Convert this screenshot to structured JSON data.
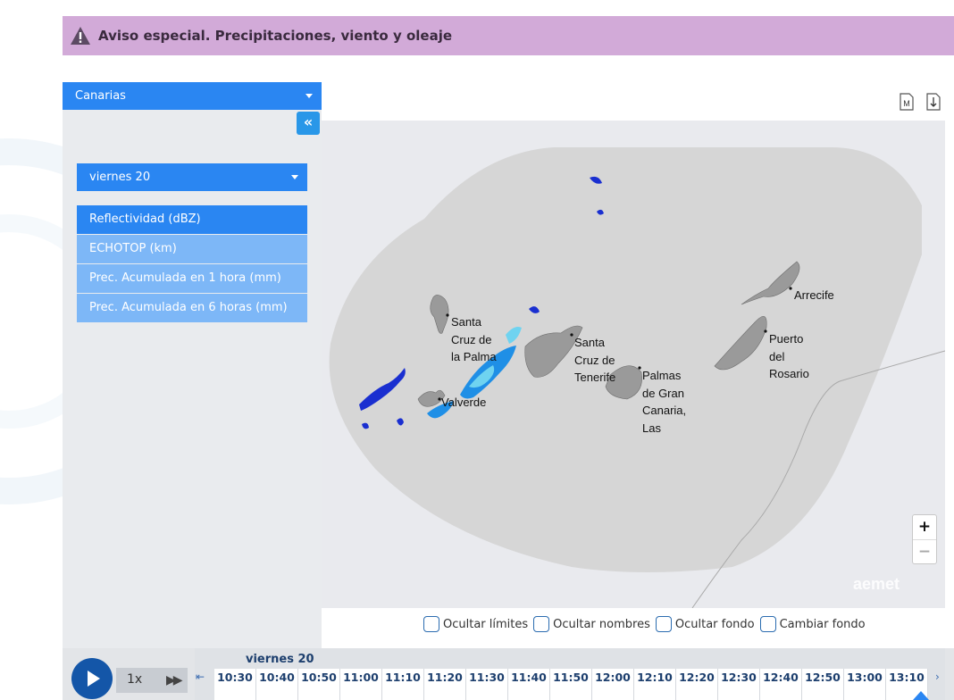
{
  "alert": {
    "text": "Aviso especial. Precipitaciones, viento y oleaje",
    "icon": "warning-icon"
  },
  "region_select": {
    "value": "Canarias"
  },
  "collapse_button": {
    "label": "«"
  },
  "day_select": {
    "value": "viernes 20"
  },
  "products": [
    {
      "label": "Reflectividad (dBZ)",
      "active": true
    },
    {
      "label": "ECHOTOP (km)",
      "active": false
    },
    {
      "label": "Prec. Acumulada en 1 hora (mm)",
      "active": false
    },
    {
      "label": "Prec. Acumulada en 6 horas (mm)",
      "active": false
    }
  ],
  "map_tools": [
    {
      "name": "map-layer-icon",
      "label": "M"
    },
    {
      "name": "download-icon",
      "label": "↓"
    }
  ],
  "map": {
    "places": [
      {
        "name": "Santa Cruz de la Palma",
        "label": "Santa\nCruz de\nla Palma"
      },
      {
        "name": "Valverde",
        "label": "Valverde"
      },
      {
        "name": "Santa Cruz de Tenerife",
        "label": "Santa\nCruz de\nTenerife"
      },
      {
        "name": "Palmas de Gran Canaria, Las",
        "label": "Palmas\nde Gran\nCanaria,\nLas"
      },
      {
        "name": "Arrecife",
        "label": "Arrecife"
      },
      {
        "name": "Puerto del Rosario",
        "label": "Puerto\ndel\nRosario"
      }
    ],
    "zoom_in": "+",
    "zoom_out": "−",
    "brand": "aemet"
  },
  "options": [
    {
      "label": "Ocultar límites",
      "checked": false
    },
    {
      "label": "Ocultar nombres",
      "checked": false
    },
    {
      "label": "Ocultar fondo",
      "checked": false
    },
    {
      "label": "Cambiar fondo",
      "checked": false
    }
  ],
  "timeline": {
    "speed": "1x",
    "day": "viernes 20",
    "times": [
      "10:30",
      "10:40",
      "10:50",
      "11:00",
      "11:10",
      "11:20",
      "11:30",
      "11:40",
      "11:50",
      "12:00",
      "12:10",
      "12:20",
      "12:30",
      "12:40",
      "12:50",
      "13:00",
      "13:10"
    ],
    "selected_time": "13:10"
  },
  "colors": {
    "alert_bg": "#d2aad8",
    "accent": "#2a86f2",
    "product_inactive": "#7db7f7",
    "timeline_text": "#1d3f6e",
    "radar_light": "#6fd3f0",
    "radar_mid": "#1f8fe6",
    "radar_dark": "#1a2fd0"
  }
}
